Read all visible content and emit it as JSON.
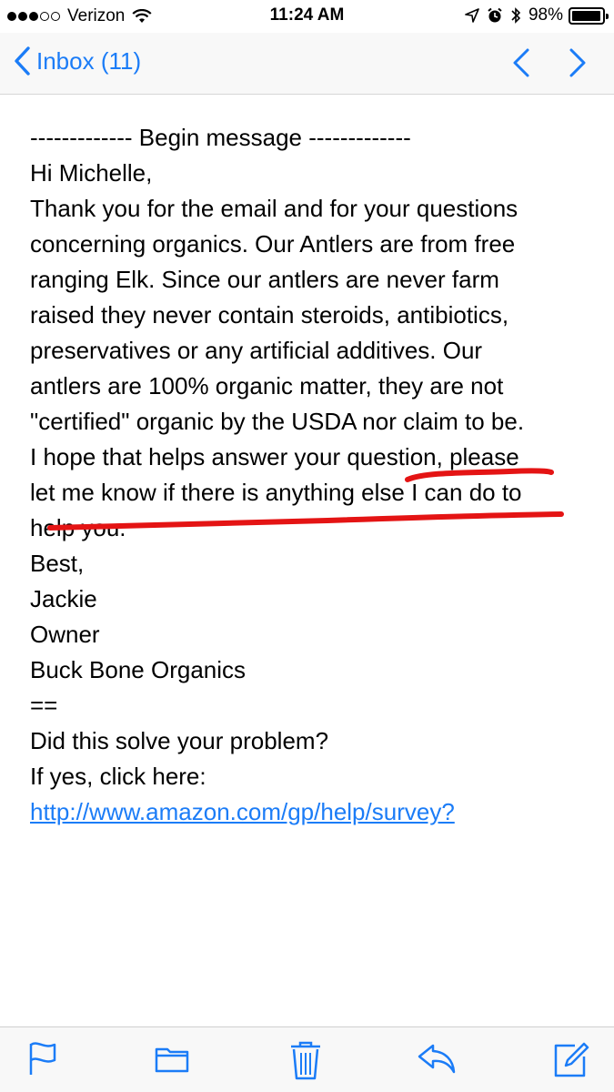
{
  "status_bar": {
    "carrier": "Verizon",
    "time": "11:24 AM",
    "battery": "98%",
    "battery_level": 0.98
  },
  "nav": {
    "back_label": "Inbox (11)"
  },
  "message": {
    "lines": [
      "------------- Begin message -------------",
      "Hi Michelle,",
      "Thank you for the email and for your questions",
      "concerning organics.  Our Antlers are from free",
      "ranging Elk. Since our antlers are never farm",
      "raised they never contain steroids, antibiotics,",
      "preservatives or any artificial additives. Our",
      "antlers are 100% organic matter, they are not",
      "\"certified\" organic by the USDA nor claim to be.",
      "I hope that helps answer your question, please",
      "let me know if there is anything else I can do to",
      "help you.",
      "Best,",
      "Jackie",
      "Owner",
      "Buck Bone Organics",
      "==",
      "Did this solve your problem?",
      "If yes, click here:",
      "http://www.amazon.com/gp/help/survey?"
    ]
  },
  "colors": {
    "ios_blue": "#1b7cf7",
    "annotation_red": "#e41414"
  },
  "toolbar": {
    "icons": [
      "flag-icon",
      "folder-icon",
      "trash-icon",
      "reply-icon",
      "compose-icon"
    ]
  }
}
